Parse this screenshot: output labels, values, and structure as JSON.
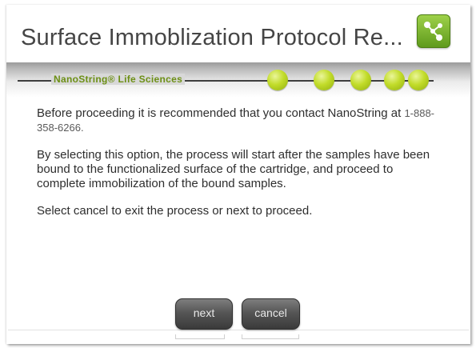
{
  "dialog": {
    "title": "Surface Immoblization Protocol Re...",
    "app_icon": "network-nodes-icon"
  },
  "brand": {
    "name": "NanoString® Life Sciences",
    "dot_color": "#c2dc2a",
    "dot_count": 5
  },
  "content": {
    "para1_prefix": "Before proceeding it is recommended that you contact NanoString at ",
    "phone": "1-888-358-6266.",
    "para2": "By selecting this option, the process will start after the samples have been bound to the functionalized surface of the cartridge, and proceed to complete immobilization of the bound samples.",
    "para3": "Select cancel to exit the process or next to proceed."
  },
  "buttons": {
    "next_label": "next",
    "cancel_label": "cancel"
  }
}
